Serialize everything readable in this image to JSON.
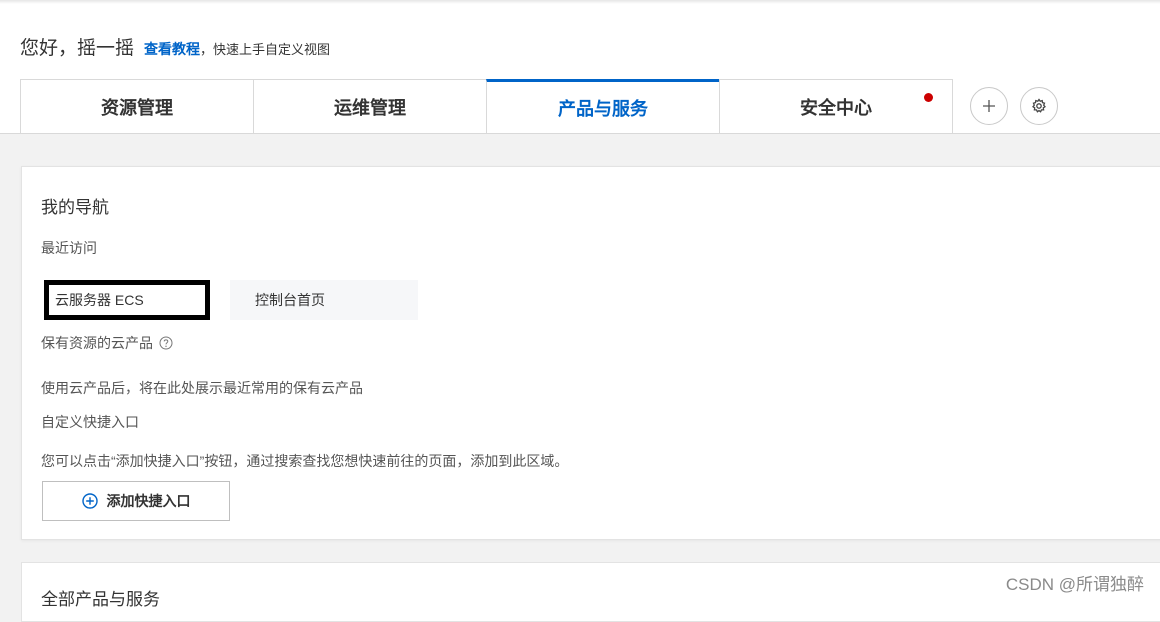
{
  "greeting": {
    "text": "您好，摇一摇",
    "tutorial_link": "查看教程",
    "tutorial_suffix": "，快速上手自定义视图"
  },
  "tabs": [
    {
      "label": "资源管理",
      "active": false
    },
    {
      "label": "运维管理",
      "active": false
    },
    {
      "label": "产品与服务",
      "active": true
    },
    {
      "label": "安全中心",
      "active": false,
      "notification_dot": true
    }
  ],
  "toolbar": {
    "add_icon": "plus-icon",
    "settings_icon": "gear-icon"
  },
  "nav": {
    "title": "我的导航",
    "recent_label": "最近访问",
    "recent_items": [
      {
        "label": "云服务器 ECS"
      },
      {
        "label": "控制台首页"
      }
    ],
    "owned_label": "保有资源的云产品",
    "owned_help_icon": "question-circle-icon",
    "owned_empty_text": "使用云产品后，将在此处展示最近常用的保有云产品",
    "shortcut_label": "自定义快捷入口",
    "shortcut_hint": "您可以点击“添加快捷入口”按钮，通过搜索查找您想快速前往的页面，添加到此区域。",
    "add_shortcut_button": "添加快捷入口",
    "add_shortcut_icon": "plus-circle-icon"
  },
  "all_products": {
    "title": "全部产品与服务"
  },
  "watermark": "CSDN @所谓独醉",
  "colors": {
    "accent": "#0064c8",
    "notification_dot": "#cc0000",
    "highlight_border": "#000000"
  }
}
